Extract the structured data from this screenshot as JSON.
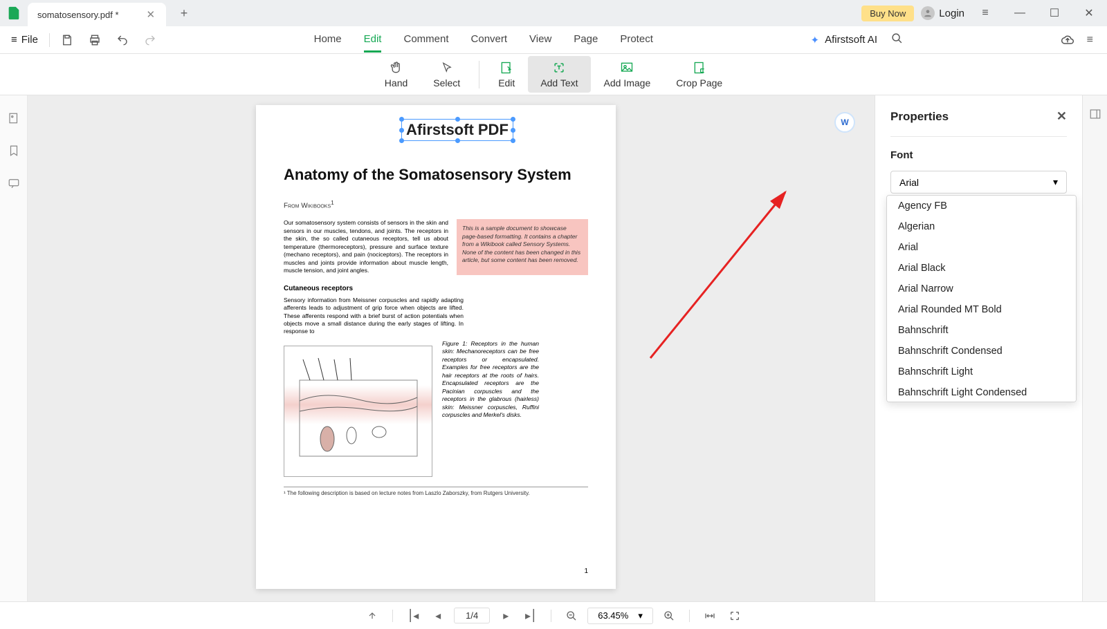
{
  "titlebar": {
    "tab_name": "somatosensory.pdf *",
    "buy_now": "Buy Now",
    "login": "Login"
  },
  "toolbar": {
    "file": "File",
    "tabs": [
      "Home",
      "Edit",
      "Comment",
      "Convert",
      "View",
      "Page",
      "Protect"
    ],
    "active_tab": "Edit",
    "ai_label": "Afirstsoft AI"
  },
  "edit_tools": {
    "hand": "Hand",
    "select": "Select",
    "edit": "Edit",
    "add_text": "Add Text",
    "add_image": "Add Image",
    "crop": "Crop Page"
  },
  "document": {
    "textbox": "Afirstsoft PDF",
    "title": "Anatomy of the Somatosensory System",
    "from": "From Wikibooks",
    "para1": "Our somatosensory system consists of sensors in the skin and sensors in our muscles, tendons, and joints. The receptors in the skin, the so called cutaneous receptors, tell us about temperature (thermoreceptors), pressure and surface texture (mechano receptors), and pain (nociceptors). The receptors in muscles and joints provide information about muscle length, muscle tension, and joint angles.",
    "pinkbox": "This is a sample document to showcase page-based formatting. It contains a chapter from a Wikibook called Sensory Systems. None of the content has been changed in this article, but some content has been removed.",
    "subhead": "Cutaneous receptors",
    "para2": "Sensory information from Meissner corpuscles and rapidly adapting afferents leads to adjustment of grip force when objects are lifted. These afferents respond with a brief burst of action potentials when objects move a small distance during the early stages of lifting. In response to",
    "figcap": "Figure 1: Receptors in the human skin: Mechanoreceptors can be free receptors or encapsulated. Examples for free receptors are the hair receptors at the roots of hairs. Encapsulated receptors are the Pacinian corpuscles and the receptors in the glabrous (hairless) skin: Meissner corpuscles, Ruffini corpuscles and Merkel's disks.",
    "footnote": "¹ The following description is based on lecture notes from Laszlo Zaborszky, from Rutgers University.",
    "page_no": "1"
  },
  "properties": {
    "title": "Properties",
    "font_label": "Font",
    "font_value": "Arial",
    "font_options": [
      "Agency FB",
      "Algerian",
      "Arial",
      "Arial Black",
      "Arial Narrow",
      "Arial Rounded MT Bold",
      "Bahnschrift",
      "Bahnschrift Condensed",
      "Bahnschrift Light",
      "Bahnschrift Light Condensed"
    ]
  },
  "statusbar": {
    "page": "1/4",
    "zoom": "63.45%"
  }
}
